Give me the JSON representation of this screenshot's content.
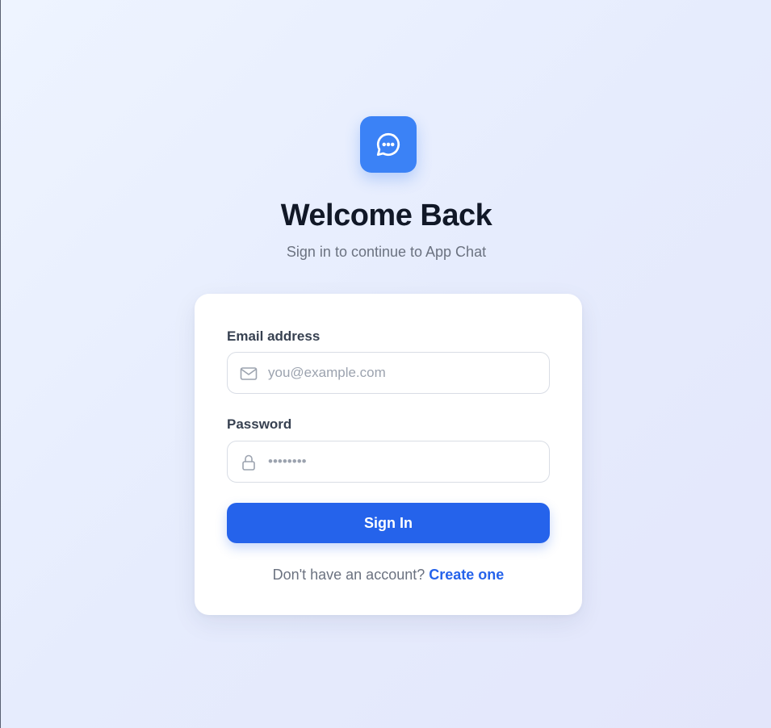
{
  "header": {
    "logo_icon": "chat-bubble-icon",
    "title": "Welcome Back",
    "subtitle": "Sign in to continue to App Chat"
  },
  "form": {
    "email": {
      "label": "Email address",
      "placeholder": "you@example.com",
      "value": "",
      "icon": "mail-icon"
    },
    "password": {
      "label": "Password",
      "placeholder": "••••••••",
      "value": "",
      "icon": "lock-icon"
    },
    "submit_label": "Sign In"
  },
  "footer": {
    "prompt": "Don't have an account?",
    "link_label": "Create one"
  },
  "colors": {
    "accent": "#2563eb",
    "logo_bg": "#3b82f6",
    "title": "#111827",
    "muted": "#6b7280"
  }
}
